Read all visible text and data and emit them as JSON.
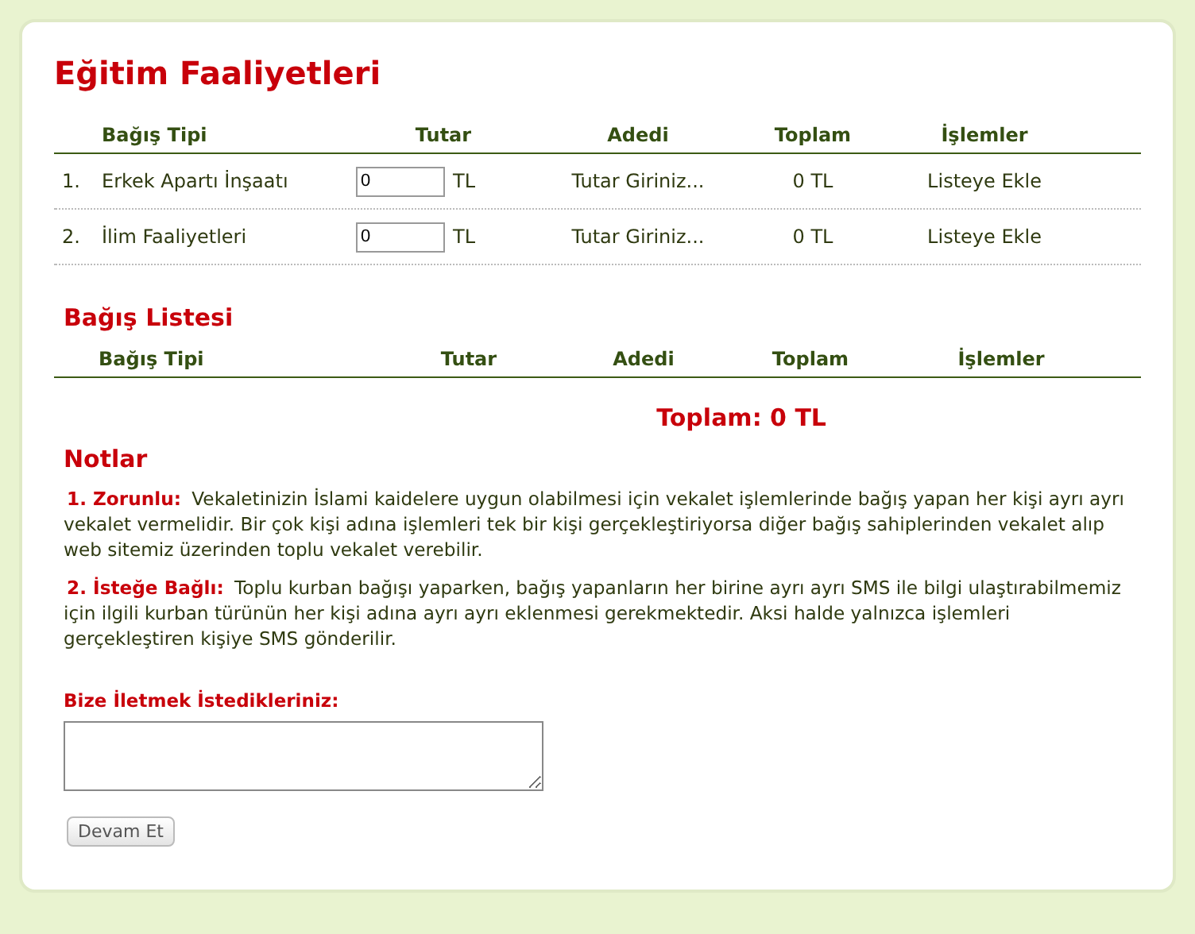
{
  "title": "Eğitim Faaliyetleri",
  "donation_table": {
    "columns": [
      "Bağış Tipi",
      "Tutar",
      "Adedi",
      "Toplam",
      "İşlemler"
    ],
    "rows": [
      {
        "number": "1.",
        "name": "Erkek Apartı İnşaatı",
        "amount": "0",
        "currency": "TL",
        "count": "Tutar Giriniz...",
        "total": "0 TL",
        "action": "Listeye Ekle"
      },
      {
        "number": "2.",
        "name": "İlim Faaliyetleri",
        "amount": "0",
        "currency": "TL",
        "count": "Tutar Giriniz...",
        "total": "0 TL",
        "action": "Listeye Ekle"
      }
    ]
  },
  "list": {
    "title": "Bağış Listesi",
    "columns": [
      "Bağış Tipi",
      "Tutar",
      "Adedi",
      "Toplam",
      "İşlemler"
    ],
    "grand_total": "Toplam: 0 TL"
  },
  "notes": {
    "title": "Notlar",
    "items": [
      {
        "text": "**1. Zorunlu:** Vekaletinizin İslami kaidelere uygun olabilmesi için vekalet işlemlerinde bağış yapan her kişi ayrı ayrı vekalet vermelidir. Bir çok kişi adına işlemleri tek bir kişi gerçekleştiriyorsa diğer bağış sahiplerinden vekalet alıp web sitemiz üzerinden toplu vekalet verebilir."
      },
      {
        "text": "**2. İsteğe Bağlı:** Toplu kurban bağışı yaparken, bağış yapanların her birine ayrı ayrı SMS ile bilgi ulaştırabilmemiz için ilgili kurban türünün her kişi adına ayrı ayrı eklenmesi gerekmektedir. Aksi halde yalnızca işlemleri gerçekleştiren kişiye SMS gönderilir."
      }
    ]
  },
  "message": {
    "label": "Bize İletmek İstedikleriniz:"
  },
  "submit": "Devam Et"
}
